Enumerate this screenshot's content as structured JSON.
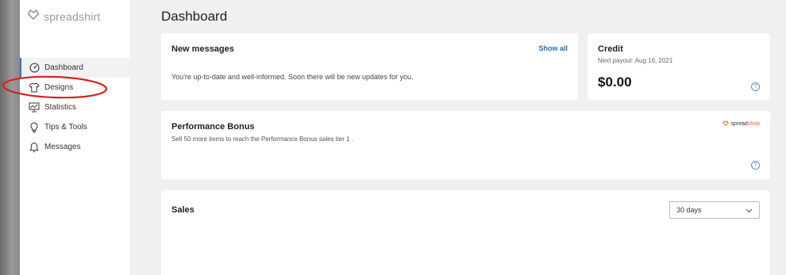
{
  "brand": {
    "name": "spreadshirt"
  },
  "sidebar": {
    "items": [
      {
        "label": "Dashboard",
        "icon": "dashboard-gauge-icon"
      },
      {
        "label": "Designs",
        "icon": "tshirt-icon"
      },
      {
        "label": "Statistics",
        "icon": "chart-monitor-icon"
      },
      {
        "label": "Tips & Tools",
        "icon": "lightbulb-icon"
      },
      {
        "label": "Messages",
        "icon": "bell-icon"
      }
    ]
  },
  "page": {
    "title": "Dashboard"
  },
  "messages": {
    "title": "New messages",
    "show_all": "Show all",
    "text": "You're up-to-date and well-informed. Soon there will be new updates for you."
  },
  "credit": {
    "title": "Credit",
    "next_payout": "Next payout: Aug 16, 2021",
    "amount": "$0.00"
  },
  "performance": {
    "title": "Performance Bonus",
    "text": "Sell 50 more items to reach the Performance Bonus sales tier 1 .",
    "badge_a": "spread",
    "badge_b": "shop"
  },
  "sales": {
    "title": "Sales",
    "range_value": "30 days"
  },
  "colors": {
    "accent": "#2b7bb9",
    "highlight": "#d9201f",
    "spreadshop": "#e86a33"
  }
}
